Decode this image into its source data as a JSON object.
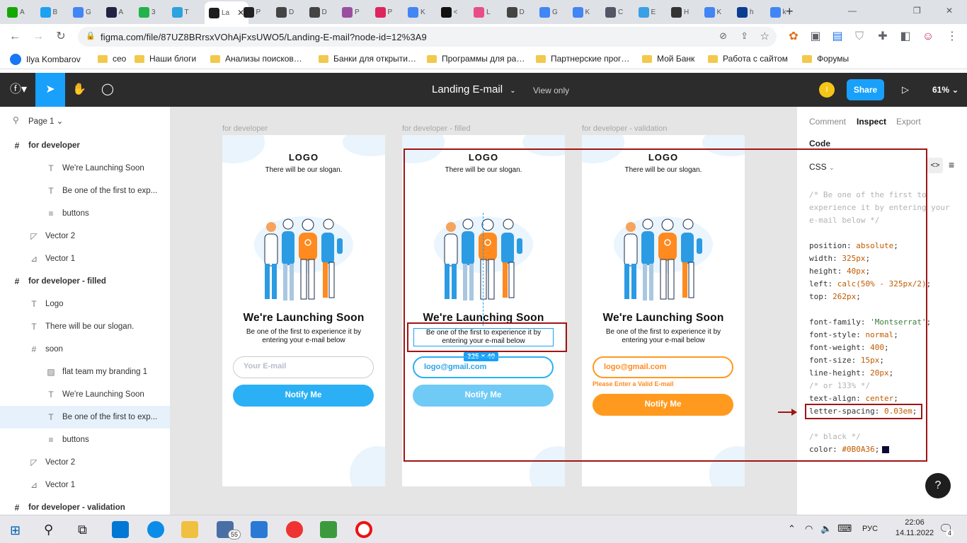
{
  "browser": {
    "tabs": [
      {
        "label": "A",
        "color": "#14a800"
      },
      {
        "label": "B",
        "color": "#1da1f2"
      },
      {
        "label": "G",
        "color": "#4285f4"
      },
      {
        "label": "A",
        "color": "#222244"
      },
      {
        "label": "3",
        "color": "#23b24b"
      },
      {
        "label": "T",
        "color": "#2aa3de"
      },
      {
        "label": "La",
        "color": "#1e1e1e",
        "active": true
      },
      {
        "label": "P",
        "color": "#222"
      },
      {
        "label": "D",
        "color": "#444"
      },
      {
        "label": "D",
        "color": "#444"
      },
      {
        "label": "P",
        "color": "#9b4fa0"
      },
      {
        "label": "P",
        "color": "#e0245e"
      },
      {
        "label": "K",
        "color": "#4285f4"
      },
      {
        "label": "<",
        "color": "#111"
      },
      {
        "label": "L",
        "color": "#ea4c89"
      },
      {
        "label": "D",
        "color": "#444"
      },
      {
        "label": "G",
        "color": "#4285f4"
      },
      {
        "label": "K",
        "color": "#4285f4"
      },
      {
        "label": "C",
        "color": "#556"
      },
      {
        "label": "E",
        "color": "#39a0e6"
      },
      {
        "label": "H",
        "color": "#333"
      },
      {
        "label": "K",
        "color": "#4285f4"
      },
      {
        "label": "h",
        "color": "#0b3d91"
      },
      {
        "label": "k",
        "color": "#4285f4"
      }
    ],
    "url": "figma.com/file/87UZ8BRrsxVOhAjFxsUWO5/Landing-E-mail?node-id=12%3A9",
    "bookmarks": [
      "Ilya Kombarov",
      "ceo",
      "Наши блоги",
      "Анализы поисков…",
      "Банки для открыти…",
      "Программы для ра…",
      "Партнерские прог…",
      "Мой Банк",
      "Работа с сайтом",
      "Форумы"
    ]
  },
  "figma": {
    "file_title": "Landing E-mail",
    "view_mode": "View only",
    "user_initial": "I",
    "share_label": "Share",
    "zoom": "61%",
    "page_selector": "Page 1",
    "layers": [
      {
        "name": "for developer",
        "type": "frame",
        "icon": "#",
        "indent": 0
      },
      {
        "name": "We're Launching Soon",
        "type": "text",
        "icon": "T",
        "indent": 2
      },
      {
        "name": "Be one of the first to exp...",
        "type": "text",
        "icon": "T",
        "indent": 2
      },
      {
        "name": "buttons",
        "type": "group",
        "icon": "≡",
        "indent": 2
      },
      {
        "name": "Vector 2",
        "type": "vector",
        "icon": "◸",
        "indent": 1
      },
      {
        "name": "Vector 1",
        "type": "vector",
        "icon": "⊿",
        "indent": 1
      },
      {
        "name": "for developer - filled",
        "type": "frame",
        "icon": "#",
        "indent": 0
      },
      {
        "name": "Logo",
        "type": "text",
        "icon": "T",
        "indent": 1
      },
      {
        "name": "There will be our slogan.",
        "type": "text",
        "icon": "T",
        "indent": 1
      },
      {
        "name": "soon",
        "type": "frame",
        "icon": "#",
        "indent": 1
      },
      {
        "name": "flat team my branding 1",
        "type": "image",
        "icon": "▨",
        "indent": 2
      },
      {
        "name": "We're Launching Soon",
        "type": "text",
        "icon": "T",
        "indent": 2
      },
      {
        "name": "Be one of the first to exp...",
        "type": "text",
        "icon": "T",
        "indent": 2,
        "selected": true
      },
      {
        "name": "buttons",
        "type": "group",
        "icon": "≡",
        "indent": 2
      },
      {
        "name": "Vector 2",
        "type": "vector",
        "icon": "◸",
        "indent": 1
      },
      {
        "name": "Vector 1",
        "type": "vector",
        "icon": "⊿",
        "indent": 1
      },
      {
        "name": "for developer - validation",
        "type": "frame",
        "icon": "#",
        "indent": 0
      }
    ],
    "frames": [
      {
        "label": "for developer",
        "logo": "LOGO",
        "slogan": "There will be our slogan.",
        "heading": "We're Launching Soon",
        "sub": "Be one of the first to experience it by entering your e-mail below",
        "input": "Your E-mail",
        "button": "Notify Me",
        "state": "empty"
      },
      {
        "label": "for developer - filled",
        "logo": "LOGO",
        "slogan": "There will be our slogan.",
        "heading": "We're Launching Soon",
        "sub": "Be one of the first to experience it by entering your e-mail below",
        "input": "logo@gmail.com",
        "button": "Notify Me",
        "state": "filled"
      },
      {
        "label": "for developer - validation",
        "logo": "LOGO",
        "slogan": "There will be our slogan.",
        "heading": "We're Launching Soon",
        "sub": "Be one of the first to experience it by entering your e-mail below",
        "input": "logo@gmail.com",
        "error": "Please Enter a Valid E-mail",
        "button": "Notify Me",
        "state": "error"
      }
    ],
    "dimension_badge": "325 × 40",
    "inspect": {
      "tabs": [
        "Comment",
        "Inspect",
        "Export"
      ],
      "section": "Code",
      "language": "CSS",
      "css_lines": [
        {
          "t": "c",
          "s": "/* Be one of the first to"
        },
        {
          "t": "c",
          "s": "experience it by entering your"
        },
        {
          "t": "c",
          "s": "e-mail below */"
        },
        {
          "t": "kv",
          "k": "position: ",
          "v": "absolute",
          "e": ";"
        },
        {
          "t": "kv",
          "k": "width: ",
          "v": "325px",
          "e": ";"
        },
        {
          "t": "kv",
          "k": "height: ",
          "v": "40px",
          "e": ";"
        },
        {
          "t": "kv",
          "k": "left: ",
          "v": "calc(50% - 325px/2)",
          "e": ";"
        },
        {
          "t": "kv",
          "k": "top: ",
          "v": "262px",
          "e": ";"
        },
        {
          "t": "kv",
          "k": "font-family: ",
          "v": "'Montserrat'",
          "e": ";"
        },
        {
          "t": "kv",
          "k": "font-style: ",
          "v": "normal",
          "e": ";"
        },
        {
          "t": "kv",
          "k": "font-weight: ",
          "v": "400",
          "e": ";"
        },
        {
          "t": "kv",
          "k": "font-size: ",
          "v": "15px",
          "e": ";"
        },
        {
          "t": "kv",
          "k": "line-height: ",
          "v": "20px",
          "e": ";"
        },
        {
          "t": "c",
          "s": "/* or 133% */"
        },
        {
          "t": "kv",
          "k": "text-align: ",
          "v": "center",
          "e": ";"
        },
        {
          "t": "kv",
          "k": "letter-spacing: ",
          "v": "0.03em",
          "e": ";"
        },
        {
          "t": "c",
          "s": "/* black */"
        },
        {
          "t": "kv",
          "k": "color: ",
          "v": "#0B0A36",
          "e": ";"
        }
      ]
    },
    "help_label": "?"
  },
  "colors": {
    "accent": "#18a0fb",
    "primary_blue": "#2bb0f5",
    "orange": "#ff9a1f",
    "annotation_red": "#a01515",
    "text_dark": "#0B0A36"
  },
  "taskbar": {
    "lang": "РУС",
    "time": "22:06",
    "date": "14.11.2022",
    "mail_badge": "55",
    "notif_badge": "4"
  }
}
